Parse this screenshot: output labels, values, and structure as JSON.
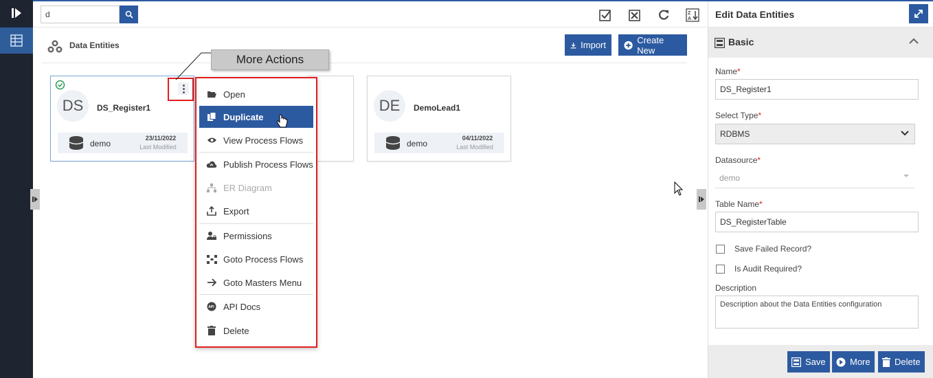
{
  "search": {
    "value": "d"
  },
  "header": {
    "title": "Data Entities",
    "import_label": "Import",
    "create_label": "Create New"
  },
  "cards": [
    {
      "initials": "DS",
      "name": "DS_Register1",
      "datasource": "demo",
      "date": "23/11/2022",
      "modified_label": "Last Modified"
    },
    {
      "initials": "DE",
      "name": "DemoLead1",
      "datasource": "demo",
      "date": "04/11/2022",
      "modified_label": "Last Modified"
    }
  ],
  "callout": "More Actions",
  "menu": [
    {
      "label": "Open",
      "icon": "folder-open-icon"
    },
    {
      "label": "Duplicate",
      "icon": "copy-icon",
      "active": true
    },
    {
      "label": "View Process Flows",
      "icon": "eye-icon"
    },
    {
      "label": "Publish Process Flows",
      "icon": "cloud-upload-icon"
    },
    {
      "label": "ER Diagram",
      "icon": "sitemap-icon",
      "disabled": true
    },
    {
      "label": "Export",
      "icon": "export-icon"
    },
    {
      "label": "Permissions",
      "icon": "user-lock-icon"
    },
    {
      "label": "Goto Process Flows",
      "icon": "process-flow-icon"
    },
    {
      "label": "Goto Masters Menu",
      "icon": "arrow-right-icon"
    },
    {
      "label": "API Docs",
      "icon": "api-icon"
    },
    {
      "label": "Delete",
      "icon": "trash-icon"
    }
  ],
  "panel": {
    "title": "Edit Data Entities",
    "section": "Basic",
    "name_label": "Name",
    "name_value": "DS_Register1",
    "type_label": "Select Type",
    "type_value": "RDBMS",
    "datasource_label": "Datasource",
    "datasource_value": "demo",
    "table_label": "Table Name",
    "table_value": "DS_RegisterTable",
    "save_failed_label": "Save Failed Record?",
    "audit_label": "Is Audit Required?",
    "description_label": "Description",
    "description_placeholder": "Description about the Data Entities configuration",
    "save_label": "Save",
    "more_label": "More",
    "delete_label": "Delete",
    "required_mark": "*"
  },
  "colors": {
    "accent": "#2c5aa0",
    "rail": "#1f2530",
    "highlight": "#e01e1e"
  }
}
